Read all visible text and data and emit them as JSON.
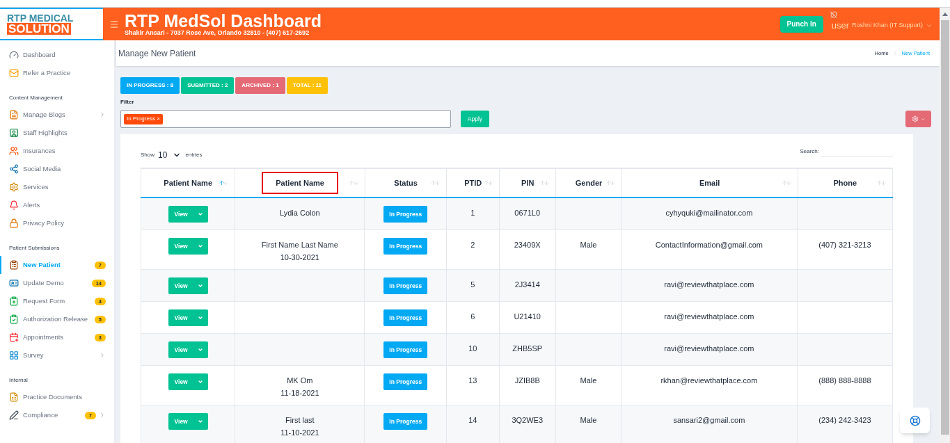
{
  "logo": {
    "line1": "RTP MEDICAL",
    "line2": "SOLUTION"
  },
  "header": {
    "title": "RTP MedSol Dashboard",
    "subtitle": "Shakir Ansari - 7037 Rose Ave, Orlando 32810 - (407) 617-2692",
    "punch_button": "Punch In",
    "user_alt": "user",
    "user_name": "Roshni Khan (IT Support)"
  },
  "sidebar": {
    "sections": [
      {
        "items": [
          {
            "label": "Dashboard",
            "selected": false
          },
          {
            "label": "Refer a Practice",
            "selected": false
          }
        ]
      },
      {
        "heading": "Content Management",
        "items": [
          {
            "label": "Manage Blogs",
            "selected": false,
            "submenu": true
          },
          {
            "label": "Staff Highlights",
            "selected": false
          },
          {
            "label": "Insurances",
            "selected": false
          },
          {
            "label": "Social Media",
            "selected": false
          },
          {
            "label": "Services",
            "selected": false
          },
          {
            "label": "Alerts",
            "selected": false
          },
          {
            "label": "Privacy Policy",
            "selected": false
          }
        ]
      },
      {
        "heading": "Patient Submissions",
        "items": [
          {
            "label": "New Patient",
            "selected": true,
            "badge": "7"
          },
          {
            "label": "Update Demo",
            "selected": false,
            "badge": "14"
          },
          {
            "label": "Request Form",
            "selected": false,
            "badge": "4"
          },
          {
            "label": "Authorization Release",
            "selected": false,
            "badge": "5"
          },
          {
            "label": "Appointments",
            "selected": false,
            "badge": "3"
          },
          {
            "label": "Survey",
            "selected": false,
            "submenu": true
          }
        ]
      },
      {
        "heading": "Internal",
        "items": [
          {
            "label": "Practice Documents",
            "selected": false
          },
          {
            "label": "Compliance",
            "selected": false,
            "badge": "7",
            "submenu": true
          }
        ]
      }
    ]
  },
  "page_title": "Manage New Patient",
  "breadcrumb": [
    {
      "label": "Home",
      "selected": false
    },
    {
      "label": "New Patient",
      "selected": true
    }
  ],
  "status_counts": [
    {
      "label": "IN PROGRESS : 8",
      "color": "#03a9f3"
    },
    {
      "label": "SUBMITTED : 2",
      "color": "#00c292"
    },
    {
      "label": "ARCHIVED : 1",
      "color": "#e46a76"
    },
    {
      "label": "TOTAL : 11",
      "color": "#fec107"
    }
  ],
  "filter": {
    "label": "Filter",
    "tags": [
      {
        "label": "In Progress",
        "remove": "×"
      }
    ],
    "apply_button": "Apply"
  },
  "table_controls": {
    "show_label": "Show",
    "entries_value": "10",
    "entries_label": "entries",
    "search_label": "Search:"
  },
  "table": {
    "columns": [
      {
        "label": "Patient Name",
        "sorted": true,
        "highlighted": false
      },
      {
        "label": "Patient Name",
        "sorted": false,
        "highlighted": true
      },
      {
        "label": "Status",
        "sorted": false,
        "highlighted": false
      },
      {
        "label": "PTID",
        "sorted": false,
        "highlighted": false
      },
      {
        "label": "PIN",
        "sorted": false,
        "highlighted": false
      },
      {
        "label": "Gender",
        "sorted": false,
        "highlighted": false
      },
      {
        "label": "Email",
        "sorted": false,
        "highlighted": false
      },
      {
        "label": "Phone",
        "sorted": false,
        "highlighted": false
      }
    ],
    "rows": [
      {
        "view": "View",
        "name": "Lydia Colon",
        "status": "In Progress",
        "ptid": "1",
        "pin": "0671L0",
        "email": "cyhyquki@mailinator.com"
      },
      {
        "view": "View",
        "name": "First Name Last Name",
        "date": "10-30-2021",
        "status": "In Progress",
        "ptid": "2",
        "pin": "23409X",
        "gender": "Male",
        "email": "ContactInformation@gmail.com",
        "phone": "(407) 321-3213"
      },
      {
        "view": "View",
        "status": "In Progress",
        "ptid": "5",
        "pin": "2J3414",
        "email": "ravi@reviewthatplace.com"
      },
      {
        "view": "View",
        "status": "In Progress",
        "ptid": "6",
        "pin": "U21410",
        "email": "ravi@reviewthatplace.com"
      },
      {
        "view": "View",
        "status": "In Progress",
        "ptid": "10",
        "pin": "ZHB5SP",
        "email": "ravi@reviewthatplace.com"
      },
      {
        "view": "View",
        "name": "MK Om",
        "date": "11-18-2021",
        "status": "In Progress",
        "ptid": "13",
        "pin": "JZIB8B",
        "gender": "Male",
        "email": "rkhan@reviewthatplace.com",
        "phone": "(888) 888-8888"
      },
      {
        "view": "View",
        "name": "First last",
        "date": "11-10-2021",
        "status": "In Progress",
        "ptid": "14",
        "pin": "3Q2WE3",
        "gender": "Male",
        "email": "sansari2@gmail.com",
        "phone": "(234) 242-3423"
      }
    ]
  }
}
